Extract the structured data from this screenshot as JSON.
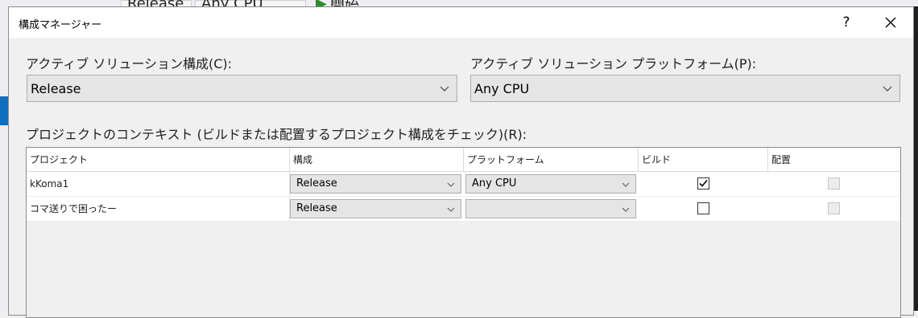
{
  "background_toolbar": {
    "config_value": "Release",
    "platform_value": "Any CPU",
    "start_label": "開始"
  },
  "dialog": {
    "title": "構成マネージャー",
    "help_label": "?",
    "close_label": "close"
  },
  "solution_config": {
    "label": "アクティブ ソリューション構成(C):",
    "value": "Release"
  },
  "solution_platform": {
    "label": "アクティブ ソリューション プラットフォーム(P):",
    "value": "Any CPU"
  },
  "contexts": {
    "label": "プロジェクトのコンテキスト (ビルドまたは配置するプロジェクト構成をチェック)(R):",
    "columns": [
      "プロジェクト",
      "構成",
      "プラットフォーム",
      "ビルド",
      "配置"
    ],
    "rows": [
      {
        "project": "kKoma1",
        "config": "Release",
        "platform": "Any CPU",
        "build": true,
        "deploy": false
      },
      {
        "project": "コマ送りで困ったー",
        "config": "Release",
        "platform": "",
        "build": false,
        "deploy": false
      }
    ]
  },
  "colors": {
    "dialog_bg": "#f0f0f0",
    "combo_bg": "#e5e5e5",
    "accent": "#0e6fc1"
  },
  "icons": [
    "chevron-down-icon",
    "close-icon",
    "help-icon",
    "checkmark-icon",
    "play-icon"
  ]
}
